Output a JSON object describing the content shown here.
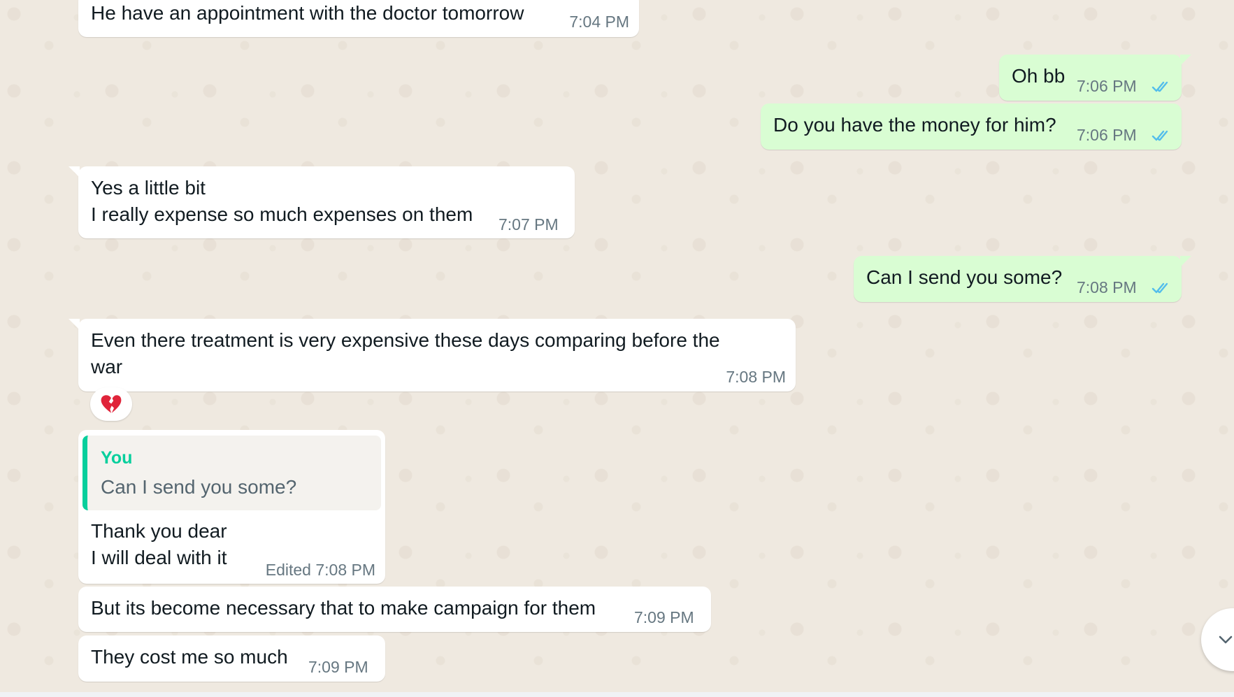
{
  "messages": [
    {
      "id": "m1",
      "direction": "incoming",
      "lines": [
        "He have an appointment with the doctor tomorrow"
      ],
      "time": "7:04 PM"
    },
    {
      "id": "m2",
      "direction": "outgoing",
      "lines": [
        "Oh bb"
      ],
      "time": "7:06 PM",
      "status": "read"
    },
    {
      "id": "m3",
      "direction": "outgoing",
      "lines": [
        "Do you have the money for him?"
      ],
      "time": "7:06 PM",
      "status": "read"
    },
    {
      "id": "m4",
      "direction": "incoming",
      "lines": [
        "Yes a little bit",
        "I really expense so much expenses on them"
      ],
      "time": "7:07 PM"
    },
    {
      "id": "m5",
      "direction": "outgoing",
      "lines": [
        "Can I send you some?"
      ],
      "time": "7:08 PM",
      "status": "read"
    },
    {
      "id": "m6",
      "direction": "incoming",
      "lines": [
        "Even there treatment is very expensive these days comparing before the",
        "war"
      ],
      "time": "7:08 PM",
      "reaction": "💔"
    },
    {
      "id": "m7",
      "direction": "incoming",
      "quote": {
        "author": "You",
        "text": "Can I send you some?"
      },
      "lines": [
        "Thank you dear",
        "I will deal with it"
      ],
      "time": "Edited 7:08 PM"
    },
    {
      "id": "m8",
      "direction": "incoming",
      "lines": [
        "But its become necessary that to make campaign for them"
      ],
      "time": "7:09 PM"
    },
    {
      "id": "m9",
      "direction": "incoming",
      "lines": [
        "They cost me so much"
      ],
      "time": "7:09 PM"
    }
  ],
  "icons": {
    "read_receipt": "double-check-icon",
    "scroll_down": "chevron-down-icon"
  },
  "colors": {
    "incoming_bubble": "#ffffff",
    "outgoing_bubble": "#d9fdd3",
    "quote_accent": "#06cf9c",
    "read_tick": "#53bdeb",
    "timestamp": "#667781"
  }
}
